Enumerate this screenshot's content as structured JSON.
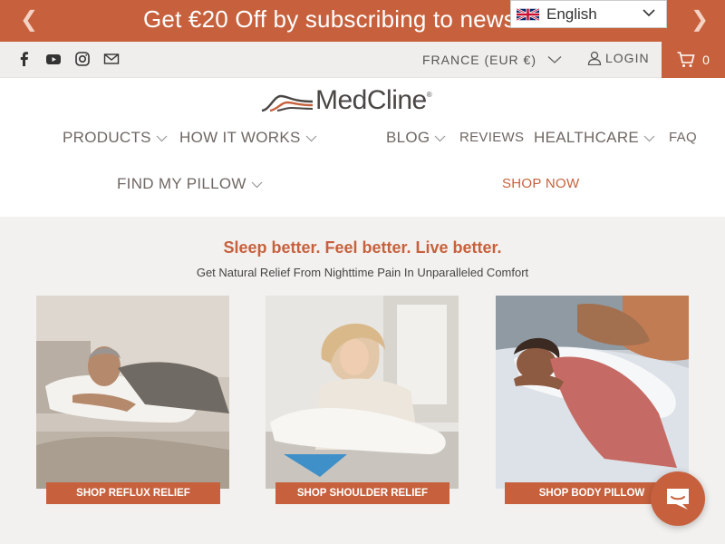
{
  "announcement": {
    "text": "Get €20 Off by subscribing to newsletter",
    "prev_icon": "chevron-left-icon",
    "next_icon": "chevron-right-icon"
  },
  "language": {
    "selected": "English",
    "flag_icon": "uk-flag-icon"
  },
  "utility": {
    "social_icons": [
      "facebook-icon",
      "youtube-icon",
      "instagram-icon",
      "mail-icon"
    ],
    "currency": "FRANCE (EUR €)",
    "login": "LOGIN",
    "cart_count": "0"
  },
  "header": {
    "logo_text": "MedCline",
    "logo_reg": "®",
    "nav": {
      "products": "PRODUCTS",
      "how_it_works": "HOW IT WORKS",
      "blog": "BLOG",
      "reviews": "REVIEWS",
      "healthcare": "HEALTHCARE",
      "faq": "FAQ",
      "find_my_pillow": "FIND MY PILLOW",
      "shop_now": "SHOP NOW"
    }
  },
  "hero": {
    "tagline": "Sleep better. Feel better. Live better.",
    "subtagline": "Get Natural Relief From Nighttime Pain In Unparalleled Comfort",
    "cards": [
      {
        "button": "SHOP REFLUX RELIEF"
      },
      {
        "button": "SHOP SHOULDER RELIEF"
      },
      {
        "button": "SHOP BODY PILLOW"
      }
    ]
  },
  "colors": {
    "accent": "#c7613d",
    "background": "#f3f1ef",
    "text": "#6f6763"
  }
}
